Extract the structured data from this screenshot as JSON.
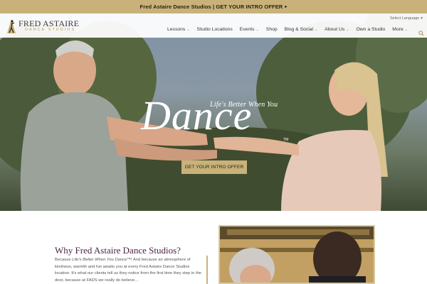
{
  "promo": {
    "text": "Fred Astaire Dance Studios | GET YOUR INTRO OFFER",
    "arrow": "▸"
  },
  "header": {
    "logo_name": "FRED ASTAIRE",
    "logo_sub": "DANCE STUDIOS",
    "language": "Select Language",
    "nav": [
      {
        "label": "Lessons",
        "has_dropdown": true
      },
      {
        "label": "Studio Locations",
        "has_dropdown": false
      },
      {
        "label": "Events",
        "has_dropdown": true
      },
      {
        "label": "Shop",
        "has_dropdown": false
      },
      {
        "label": "Blog & Social",
        "has_dropdown": true
      },
      {
        "label": "About Us",
        "has_dropdown": true
      },
      {
        "label": "Own a Studio",
        "has_dropdown": false
      },
      {
        "label": "More",
        "has_dropdown": true
      }
    ]
  },
  "hero": {
    "tagline": "Life's Better When You",
    "headline": "Dance",
    "tm": "TM",
    "cta_label": "GET YOUR INTRO OFFER"
  },
  "section": {
    "title": "Why Fred Astaire Dance Studios?",
    "body_prefix": "Because ",
    "body_em": "Life's Better When You Dance",
    "body_rest": "™! And because an atmosphere of kindness, warmth and fun awaits you at every Fred Astaire Dance Studios location. It's what our clients tell us they notice from the first time they step in the door, because at FADS we really do believe..."
  },
  "colors": {
    "gold": "#c9b27a",
    "plum": "#4a2244"
  },
  "icons": {
    "search": "search-icon",
    "dropdown": "chevron-down-icon",
    "logo": "dancer-logo-icon"
  }
}
